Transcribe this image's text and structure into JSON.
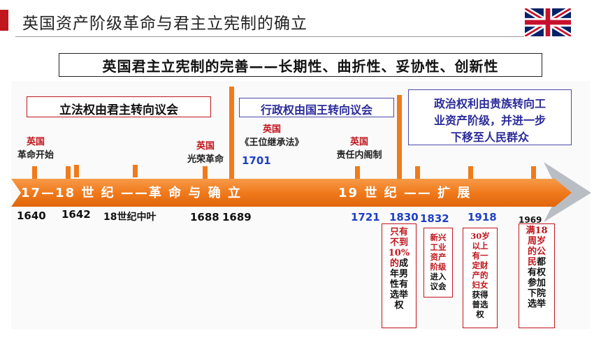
{
  "header": {
    "title": "英国资产阶级革命与君主立宪制的确立"
  },
  "subtitle": "英国君主立宪制的完善——长期性、曲折性、妥协性、创新性",
  "phases": {
    "legislative": "立法权由君主转向议会",
    "executive": "行政权由国王转向议会",
    "political_line1": "政治权利由贵族转向工",
    "political_line2": "业资产阶级，并进一步",
    "political_line3": "下移至人民群众"
  },
  "events": {
    "e1_head": "英国",
    "e1_body": "革命开始",
    "e2_head": "英国",
    "e2_body": "光荣革命",
    "e3_head": "英国",
    "e3_body": "《王位继承法》",
    "e3_year": "1701",
    "e4_head": "英国",
    "e4_body": "责任内阁制"
  },
  "band": {
    "left": "17—18 世 纪 ——革 命 与 确 立",
    "right": "19  世   纪 —— 扩   展"
  },
  "years": {
    "y1640": "1640",
    "y1642": "1642",
    "ymid18": "18世纪中叶",
    "y1688": "1688",
    "y1689": "1689",
    "y1721": "1721",
    "y1830": "1830",
    "y1832": "1832",
    "y1918": "1918",
    "y1969": "1969"
  },
  "notes": {
    "n1830": [
      "只有",
      "不到",
      "10%",
      "的成",
      "年男",
      "性有",
      "选举",
      "权"
    ],
    "n1832": [
      "新兴",
      "工业",
      "资产",
      "阶级",
      "进入",
      "议会"
    ],
    "n1918": [
      "30岁",
      "以上",
      "有一",
      "定财",
      "产的",
      "妇女",
      "获得",
      "普选",
      "权"
    ],
    "n1969": [
      "满18",
      "周岁",
      "的公",
      "民都",
      "有权",
      "参加",
      "下院",
      "选举"
    ]
  },
  "colors": {
    "accent_red": "#c0161d",
    "timeline_orange": "#f07a1c",
    "year_blue": "#1f3fc4",
    "box_blue": "#4a4aa8"
  },
  "icons": {
    "flag": "union-jack-flag"
  }
}
